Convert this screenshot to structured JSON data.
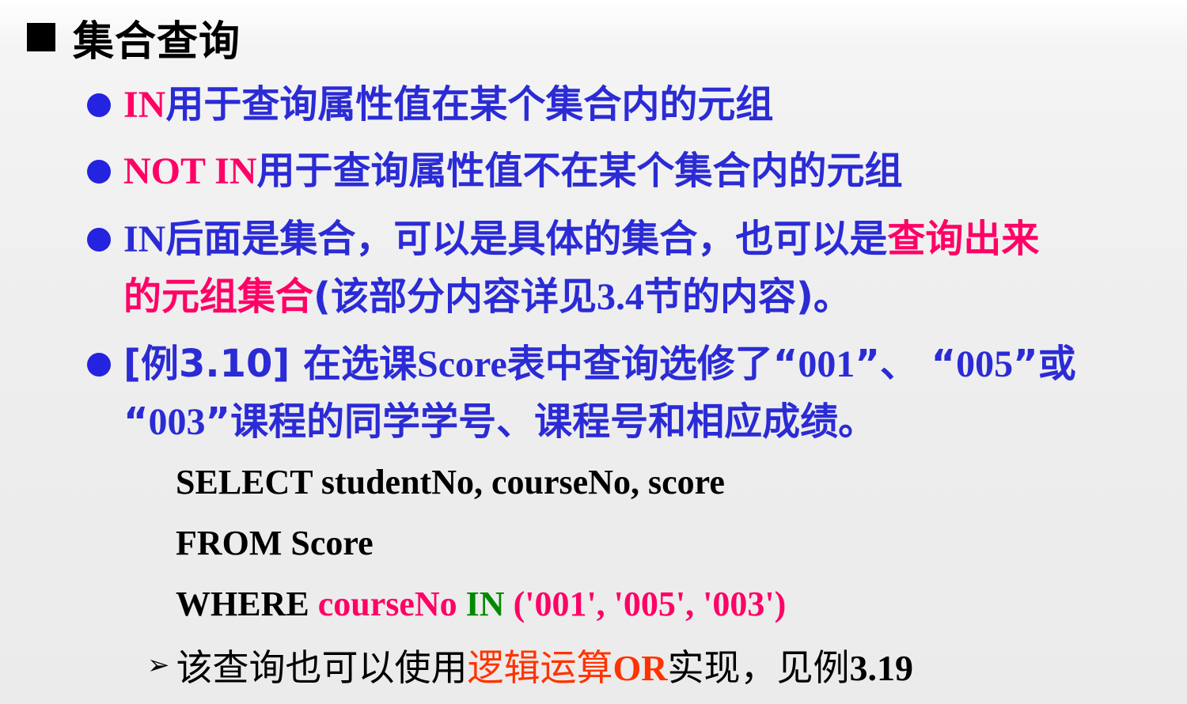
{
  "title": "集合查询",
  "bullets": [
    {
      "p1": "IN",
      "p2": "用于查询属性值在某个集合内的元组"
    },
    {
      "p1": "NOT IN",
      "p2": "用于查询属性值不在某个集合内的元组"
    },
    {
      "line1_a": " IN",
      "line1_b": "后面是集合，可以是具体的集合，也可以是",
      "line1_c": "查询出来",
      "line2_a": "的元组集合",
      "line2_b": "(该部分内容详见",
      "line2_c": "3.4",
      "line2_d": "节的内容)。"
    },
    {
      "line1_a": "[例3.10] ",
      "line1_b": "在选课",
      "line1_c": "Score",
      "line1_d": "表中查询选修了“",
      "line1_e": "001",
      "line1_f": "”、 “",
      "line1_g": "005",
      "line1_h": "”或",
      "line2_a": "“",
      "line2_b": "003",
      "line2_c": "”课程的同学学号、课程号和相应成绩。"
    }
  ],
  "code": {
    "line1": "SELECT studentNo, courseNo, score",
    "line2": "FROM Score",
    "line3_kw": "WHERE ",
    "line3_col": "courseNo ",
    "line3_in": "IN ",
    "line3_vals": "('001', '005', '003')"
  },
  "note": {
    "a": "该查询也可以使用",
    "b": "逻辑运算",
    "c": "OR",
    "d": "实现，见例",
    "e": "3.19"
  }
}
